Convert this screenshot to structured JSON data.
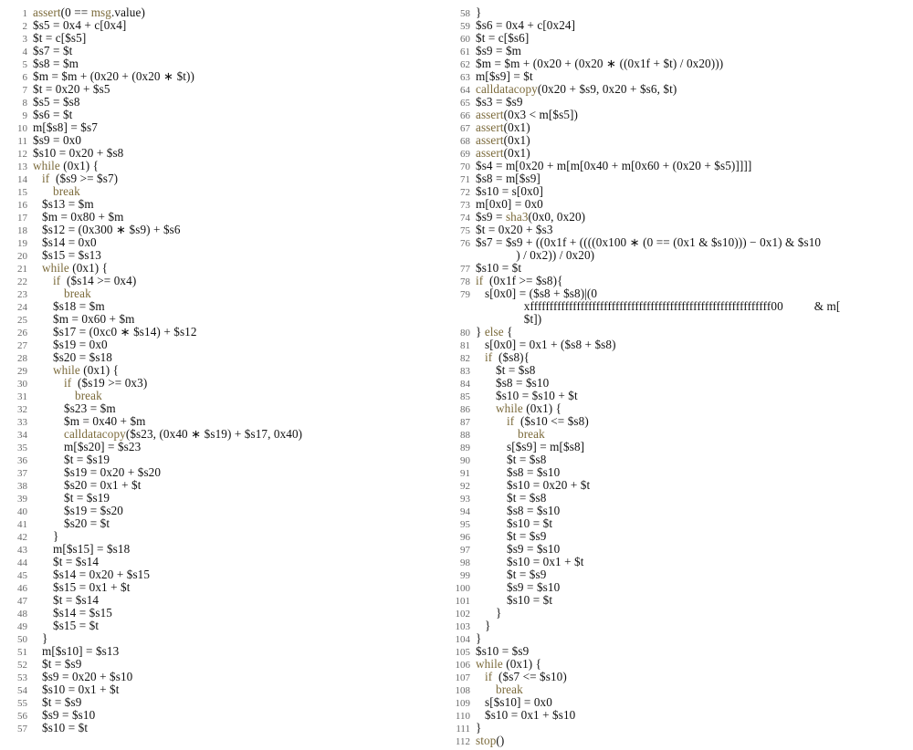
{
  "col1": [
    {
      "n": 1,
      "i": 0,
      "segs": [
        [
          "fn",
          "assert"
        ],
        [
          "",
          "(0 == "
        ],
        [
          "fn",
          "msg"
        ],
        [
          "",
          ".value)"
        ]
      ]
    },
    {
      "n": 2,
      "i": 0,
      "segs": [
        [
          "",
          "$s5 = 0x4 + c[0x4]"
        ]
      ]
    },
    {
      "n": 3,
      "i": 0,
      "segs": [
        [
          "",
          "$t = c[$s5]"
        ]
      ]
    },
    {
      "n": 4,
      "i": 0,
      "segs": [
        [
          "",
          "$s7 = $t"
        ]
      ]
    },
    {
      "n": 5,
      "i": 0,
      "segs": [
        [
          "",
          "$s8 = $m"
        ]
      ]
    },
    {
      "n": 6,
      "i": 0,
      "segs": [
        [
          "",
          "$m = $m + (0x20 + (0x20 ∗ $t))"
        ]
      ]
    },
    {
      "n": 7,
      "i": 0,
      "segs": [
        [
          "",
          "$t = 0x20 + $s5"
        ]
      ]
    },
    {
      "n": 8,
      "i": 0,
      "segs": [
        [
          "",
          "$s5 = $s8"
        ]
      ]
    },
    {
      "n": 9,
      "i": 0,
      "segs": [
        [
          "",
          "$s6 = $t"
        ]
      ]
    },
    {
      "n": 10,
      "i": 0,
      "segs": [
        [
          "",
          "m[$s8] = $s7"
        ]
      ]
    },
    {
      "n": 11,
      "i": 0,
      "segs": [
        [
          "",
          "$s9 = 0x0"
        ]
      ]
    },
    {
      "n": 12,
      "i": 0,
      "segs": [
        [
          "",
          "$s10 = 0x20 + $s8"
        ]
      ]
    },
    {
      "n": 13,
      "i": 0,
      "segs": [
        [
          "kw",
          "while"
        ],
        [
          "",
          " (0x1) {"
        ]
      ]
    },
    {
      "n": 14,
      "i": 1,
      "segs": [
        [
          "kw",
          "if"
        ],
        [
          "",
          "  ($s9 >= $s7)"
        ]
      ]
    },
    {
      "n": 15,
      "i": 2,
      "segs": [
        [
          "kw",
          "break"
        ]
      ]
    },
    {
      "n": 16,
      "i": 1,
      "segs": [
        [
          "",
          "$s13 = $m"
        ]
      ]
    },
    {
      "n": 17,
      "i": 1,
      "segs": [
        [
          "",
          "$m = 0x80 + $m"
        ]
      ]
    },
    {
      "n": 18,
      "i": 1,
      "segs": [
        [
          "",
          "$s12 = (0x300 ∗ $s9) + $s6"
        ]
      ]
    },
    {
      "n": 19,
      "i": 1,
      "segs": [
        [
          "",
          "$s14 = 0x0"
        ]
      ]
    },
    {
      "n": 20,
      "i": 1,
      "segs": [
        [
          "",
          "$s15 = $s13"
        ]
      ]
    },
    {
      "n": 21,
      "i": 1,
      "segs": [
        [
          "kw",
          "while"
        ],
        [
          "",
          " (0x1) {"
        ]
      ]
    },
    {
      "n": 22,
      "i": 2,
      "segs": [
        [
          "kw",
          "if"
        ],
        [
          "",
          "  ($s14 >= 0x4)"
        ]
      ]
    },
    {
      "n": 23,
      "i": 3,
      "segs": [
        [
          "kw",
          "break"
        ]
      ]
    },
    {
      "n": 24,
      "i": 2,
      "segs": [
        [
          "",
          "$s18 = $m"
        ]
      ]
    },
    {
      "n": 25,
      "i": 2,
      "segs": [
        [
          "",
          "$m = 0x60 + $m"
        ]
      ]
    },
    {
      "n": 26,
      "i": 2,
      "segs": [
        [
          "",
          "$s17 = (0xc0 ∗ $s14) + $s12"
        ]
      ]
    },
    {
      "n": 27,
      "i": 2,
      "segs": [
        [
          "",
          "$s19 = 0x0"
        ]
      ]
    },
    {
      "n": 28,
      "i": 2,
      "segs": [
        [
          "",
          "$s20 = $s18"
        ]
      ]
    },
    {
      "n": 29,
      "i": 2,
      "segs": [
        [
          "kw",
          "while"
        ],
        [
          "",
          " (0x1) {"
        ]
      ]
    },
    {
      "n": 30,
      "i": 3,
      "segs": [
        [
          "kw",
          "if"
        ],
        [
          "",
          "  ($s19 >= 0x3)"
        ]
      ]
    },
    {
      "n": 31,
      "i": 4,
      "segs": [
        [
          "kw",
          "break"
        ]
      ]
    },
    {
      "n": 32,
      "i": 3,
      "segs": [
        [
          "",
          "$s23 = $m"
        ]
      ]
    },
    {
      "n": 33,
      "i": 3,
      "segs": [
        [
          "",
          "$m = 0x40 + $m"
        ]
      ]
    },
    {
      "n": 34,
      "i": 3,
      "segs": [
        [
          "fn",
          "calldatacopy"
        ],
        [
          "",
          "($s23, (0x40 ∗ $s19) + $s17, 0x40)"
        ]
      ]
    },
    {
      "n": 35,
      "i": 3,
      "segs": [
        [
          "",
          "m[$s20] = $s23"
        ]
      ]
    },
    {
      "n": 36,
      "i": 3,
      "segs": [
        [
          "",
          "$t = $s19"
        ]
      ]
    },
    {
      "n": 37,
      "i": 3,
      "segs": [
        [
          "",
          "$s19 = 0x20 + $s20"
        ]
      ]
    },
    {
      "n": 38,
      "i": 3,
      "segs": [
        [
          "",
          "$s20 = 0x1 + $t"
        ]
      ]
    },
    {
      "n": 39,
      "i": 3,
      "segs": [
        [
          "",
          "$t = $s19"
        ]
      ]
    },
    {
      "n": 40,
      "i": 3,
      "segs": [
        [
          "",
          "$s19 = $s20"
        ]
      ]
    },
    {
      "n": 41,
      "i": 3,
      "segs": [
        [
          "",
          "$s20 = $t"
        ]
      ]
    },
    {
      "n": 42,
      "i": 2,
      "segs": [
        [
          "",
          "}"
        ]
      ]
    },
    {
      "n": 43,
      "i": 2,
      "segs": [
        [
          "",
          "m[$s15] = $s18"
        ]
      ]
    },
    {
      "n": 44,
      "i": 2,
      "segs": [
        [
          "",
          "$t = $s14"
        ]
      ]
    },
    {
      "n": 45,
      "i": 2,
      "segs": [
        [
          "",
          "$s14 = 0x20 + $s15"
        ]
      ]
    },
    {
      "n": 46,
      "i": 2,
      "segs": [
        [
          "",
          "$s15 = 0x1 + $t"
        ]
      ]
    },
    {
      "n": 47,
      "i": 2,
      "segs": [
        [
          "",
          "$t = $s14"
        ]
      ]
    },
    {
      "n": 48,
      "i": 2,
      "segs": [
        [
          "",
          "$s14 = $s15"
        ]
      ]
    },
    {
      "n": 49,
      "i": 2,
      "segs": [
        [
          "",
          "$s15 = $t"
        ]
      ]
    },
    {
      "n": 50,
      "i": 1,
      "segs": [
        [
          "",
          "}"
        ]
      ]
    },
    {
      "n": 51,
      "i": 1,
      "segs": [
        [
          "",
          "m[$s10] = $s13"
        ]
      ]
    },
    {
      "n": 52,
      "i": 1,
      "segs": [
        [
          "",
          "$t = $s9"
        ]
      ]
    },
    {
      "n": 53,
      "i": 1,
      "segs": [
        [
          "",
          "$s9 = 0x20 + $s10"
        ]
      ]
    },
    {
      "n": 54,
      "i": 1,
      "segs": [
        [
          "",
          "$s10 = 0x1 + $t"
        ]
      ]
    },
    {
      "n": 55,
      "i": 1,
      "segs": [
        [
          "",
          "$t = $s9"
        ]
      ]
    },
    {
      "n": 56,
      "i": 1,
      "segs": [
        [
          "",
          "$s9 = $s10"
        ]
      ]
    },
    {
      "n": 57,
      "i": 1,
      "segs": [
        [
          "",
          "$s10 = $t"
        ]
      ]
    }
  ],
  "col2": [
    {
      "n": 58,
      "i": 0,
      "segs": [
        [
          "",
          "}"
        ]
      ]
    },
    {
      "n": 59,
      "i": 0,
      "segs": [
        [
          "",
          "$s6 = 0x4 + c[0x24]"
        ]
      ]
    },
    {
      "n": 60,
      "i": 0,
      "segs": [
        [
          "",
          "$t = c[$s6]"
        ]
      ]
    },
    {
      "n": 61,
      "i": 0,
      "segs": [
        [
          "",
          "$s9 = $m"
        ]
      ]
    },
    {
      "n": 62,
      "i": 0,
      "segs": [
        [
          "",
          "$m = $m + (0x20 + (0x20 ∗ ((0x1f + $t) / 0x20)))"
        ]
      ]
    },
    {
      "n": 63,
      "i": 0,
      "segs": [
        [
          "",
          "m[$s9] = $t"
        ]
      ]
    },
    {
      "n": 64,
      "i": 0,
      "segs": [
        [
          "fn",
          "calldatacopy"
        ],
        [
          "",
          "(0x20 + $s9, 0x20 + $s6, $t)"
        ]
      ]
    },
    {
      "n": 65,
      "i": 0,
      "segs": [
        [
          "",
          "$s3 = $s9"
        ]
      ]
    },
    {
      "n": 66,
      "i": 0,
      "segs": [
        [
          "fn",
          "assert"
        ],
        [
          "",
          "(0x3 < m[$s5])"
        ]
      ]
    },
    {
      "n": 67,
      "i": 0,
      "segs": [
        [
          "fn",
          "assert"
        ],
        [
          "",
          "(0x1)"
        ]
      ]
    },
    {
      "n": 68,
      "i": 0,
      "segs": [
        [
          "fn",
          "assert"
        ],
        [
          "",
          "(0x1)"
        ]
      ]
    },
    {
      "n": 69,
      "i": 0,
      "segs": [
        [
          "fn",
          "assert"
        ],
        [
          "",
          "(0x1)"
        ]
      ]
    },
    {
      "n": 70,
      "i": 0,
      "segs": [
        [
          "",
          "$s4 = m[0x20 + m[m[0x40 + m[0x60 + (0x20 + $s5)]]]]"
        ]
      ]
    },
    {
      "n": 71,
      "i": 0,
      "segs": [
        [
          "",
          "$s8 = m[$s9]"
        ]
      ]
    },
    {
      "n": 72,
      "i": 0,
      "segs": [
        [
          "",
          "$s10 = s[0x0]"
        ]
      ]
    },
    {
      "n": 73,
      "i": 0,
      "segs": [
        [
          "",
          "m[0x0] = 0x0"
        ]
      ]
    },
    {
      "n": 74,
      "i": 0,
      "segs": [
        [
          "",
          "$s9 = "
        ],
        [
          "fn",
          "sha3"
        ],
        [
          "",
          "(0x0, 0x20)"
        ]
      ]
    },
    {
      "n": 75,
      "i": 0,
      "segs": [
        [
          "",
          "$t = 0x20 + $s3"
        ]
      ]
    },
    {
      "n": 76,
      "i": 0,
      "segs": [
        [
          "",
          "$s7 = $s9 + ((0x1f + ((((0x100 ∗ (0 == (0x1 & $s10))) − 0x1) & $s10"
        ]
      ]
    },
    {
      "n": "",
      "i": 3,
      "segs": [
        [
          "",
          "   ) / 0x2)) / 0x20)"
        ]
      ]
    },
    {
      "n": 77,
      "i": 0,
      "segs": [
        [
          "",
          "$s10 = $t"
        ]
      ]
    },
    {
      "n": 78,
      "i": 0,
      "segs": [
        [
          "kw",
          "if"
        ],
        [
          "",
          "  (0x1f >= $s8){"
        ]
      ]
    },
    {
      "n": 79,
      "i": 1,
      "segs": [
        [
          "",
          "s[0x0] = ($s8 + $s8)|(0"
        ]
      ]
    },
    {
      "n": "",
      "i": 4,
      "segs": [
        [
          "",
          "  xffffffffffffffffffffffffffffffffffffffffffffffffffffffffffffff00          & m["
        ]
      ]
    },
    {
      "n": "",
      "i": 4,
      "segs": [
        [
          "",
          "  $t])"
        ]
      ]
    },
    {
      "n": 80,
      "i": 0,
      "segs": [
        [
          "",
          "} "
        ],
        [
          "kw",
          "else"
        ],
        [
          "",
          " {"
        ]
      ]
    },
    {
      "n": 81,
      "i": 1,
      "segs": [
        [
          "",
          "s[0x0] = 0x1 + ($s8 + $s8)"
        ]
      ]
    },
    {
      "n": 82,
      "i": 1,
      "segs": [
        [
          "kw",
          "if"
        ],
        [
          "",
          "  ($s8){"
        ]
      ]
    },
    {
      "n": 83,
      "i": 2,
      "segs": [
        [
          "",
          "$t = $s8"
        ]
      ]
    },
    {
      "n": 84,
      "i": 2,
      "segs": [
        [
          "",
          "$s8 = $s10"
        ]
      ]
    },
    {
      "n": 85,
      "i": 2,
      "segs": [
        [
          "",
          "$s10 = $s10 + $t"
        ]
      ]
    },
    {
      "n": 86,
      "i": 2,
      "segs": [
        [
          "kw",
          "while"
        ],
        [
          "",
          " (0x1) {"
        ]
      ]
    },
    {
      "n": 87,
      "i": 3,
      "segs": [
        [
          "kw",
          "if"
        ],
        [
          "",
          "  ($s10 <= $s8)"
        ]
      ]
    },
    {
      "n": 88,
      "i": 4,
      "segs": [
        [
          "kw",
          "break"
        ]
      ]
    },
    {
      "n": 89,
      "i": 3,
      "segs": [
        [
          "",
          "s[$s9] = m[$s8]"
        ]
      ]
    },
    {
      "n": 90,
      "i": 3,
      "segs": [
        [
          "",
          "$t = $s8"
        ]
      ]
    },
    {
      "n": 91,
      "i": 3,
      "segs": [
        [
          "",
          "$s8 = $s10"
        ]
      ]
    },
    {
      "n": 92,
      "i": 3,
      "segs": [
        [
          "",
          "$s10 = 0x20 + $t"
        ]
      ]
    },
    {
      "n": 93,
      "i": 3,
      "segs": [
        [
          "",
          "$t = $s8"
        ]
      ]
    },
    {
      "n": 94,
      "i": 3,
      "segs": [
        [
          "",
          "$s8 = $s10"
        ]
      ]
    },
    {
      "n": 95,
      "i": 3,
      "segs": [
        [
          "",
          "$s10 = $t"
        ]
      ]
    },
    {
      "n": 96,
      "i": 3,
      "segs": [
        [
          "",
          "$t = $s9"
        ]
      ]
    },
    {
      "n": 97,
      "i": 3,
      "segs": [
        [
          "",
          "$s9 = $s10"
        ]
      ]
    },
    {
      "n": 98,
      "i": 3,
      "segs": [
        [
          "",
          "$s10 = 0x1 + $t"
        ]
      ]
    },
    {
      "n": 99,
      "i": 3,
      "segs": [
        [
          "",
          "$t = $s9"
        ]
      ]
    },
    {
      "n": 100,
      "i": 3,
      "segs": [
        [
          "",
          "$s9 = $s10"
        ]
      ]
    },
    {
      "n": 101,
      "i": 3,
      "segs": [
        [
          "",
          "$s10 = $t"
        ]
      ]
    },
    {
      "n": 102,
      "i": 2,
      "segs": [
        [
          "",
          "}"
        ]
      ]
    },
    {
      "n": 103,
      "i": 1,
      "segs": [
        [
          "",
          "}"
        ]
      ]
    },
    {
      "n": 104,
      "i": 0,
      "segs": [
        [
          "",
          "}"
        ]
      ]
    },
    {
      "n": 105,
      "i": 0,
      "segs": [
        [
          "",
          "$s10 = $s9"
        ]
      ]
    },
    {
      "n": 106,
      "i": 0,
      "segs": [
        [
          "kw",
          "while"
        ],
        [
          "",
          " (0x1) {"
        ]
      ]
    },
    {
      "n": 107,
      "i": 1,
      "segs": [
        [
          "kw",
          "if"
        ],
        [
          "",
          "  ($s7 <= $s10)"
        ]
      ]
    },
    {
      "n": 108,
      "i": 2,
      "segs": [
        [
          "kw",
          "break"
        ]
      ]
    },
    {
      "n": 109,
      "i": 1,
      "segs": [
        [
          "",
          "s[$s10] = 0x0"
        ]
      ]
    },
    {
      "n": 110,
      "i": 1,
      "segs": [
        [
          "",
          "$s10 = 0x1 + $s10"
        ]
      ]
    },
    {
      "n": 111,
      "i": 0,
      "segs": [
        [
          "",
          "}"
        ]
      ]
    },
    {
      "n": 112,
      "i": 0,
      "segs": [
        [
          "fn",
          "stop"
        ],
        [
          "",
          "()"
        ]
      ]
    }
  ]
}
